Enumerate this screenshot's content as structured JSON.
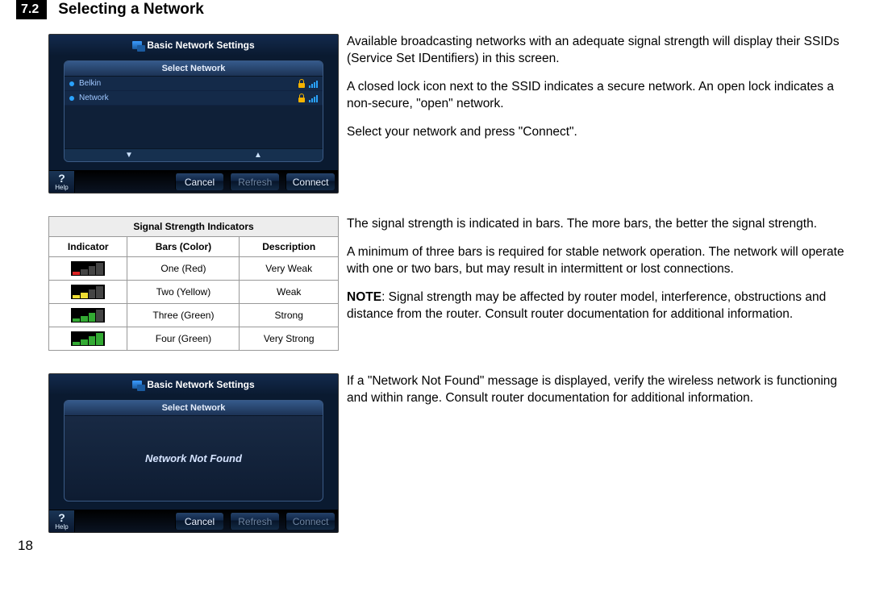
{
  "section_number": "7.2",
  "section_title": "Selecting a Network",
  "screenshot1": {
    "title": "Basic Network Settings",
    "subtitle": "Select Network",
    "rows": [
      {
        "name": "Belkin"
      },
      {
        "name": "Network"
      }
    ],
    "help": "Help",
    "cancel": "Cancel",
    "refresh": "Refresh",
    "connect": "Connect"
  },
  "text1": {
    "p1": "Available broadcasting networks with an adequate signal strength will display their SSIDs (Service Set IDentifiers) in this screen.",
    "p2": "A closed lock icon next to the SSID indicates a secure network. An open lock indicates a non-secure, \"open\" network.",
    "p3": "Select your network and press \"Connect\"."
  },
  "sig_table": {
    "title": "Signal Strength Indicators",
    "h1": "Indicator",
    "h2": "Bars (Color)",
    "h3": "Description",
    "r1b": "One (Red)",
    "r1d": "Very Weak",
    "r2b": "Two (Yellow)",
    "r2d": "Weak",
    "r3b": "Three (Green)",
    "r3d": "Strong",
    "r4b": "Four (Green)",
    "r4d": "Very Strong"
  },
  "text2": {
    "p1": "The signal strength is indicated in bars. The more bars, the better the signal strength.",
    "p2": "A minimum of three bars is required for stable network operation. The network will operate with one or two bars, but may result in intermittent or lost connections.",
    "p3_note": "NOTE",
    "p3": ": Signal strength may be affected by router model, interference, obstructions and distance from the router. Consult router documentation for additional information."
  },
  "screenshot2": {
    "title": "Basic Network Settings",
    "subtitle": "Select Network",
    "msg": "Network Not Found",
    "help": "Help",
    "cancel": "Cancel",
    "refresh": "Refresh",
    "connect": "Connect"
  },
  "text3": {
    "p1": "If a \"Network Not Found\" message is displayed, verify the wireless network is functioning and within range. Consult router documentation for additional information."
  },
  "page_number": "18"
}
